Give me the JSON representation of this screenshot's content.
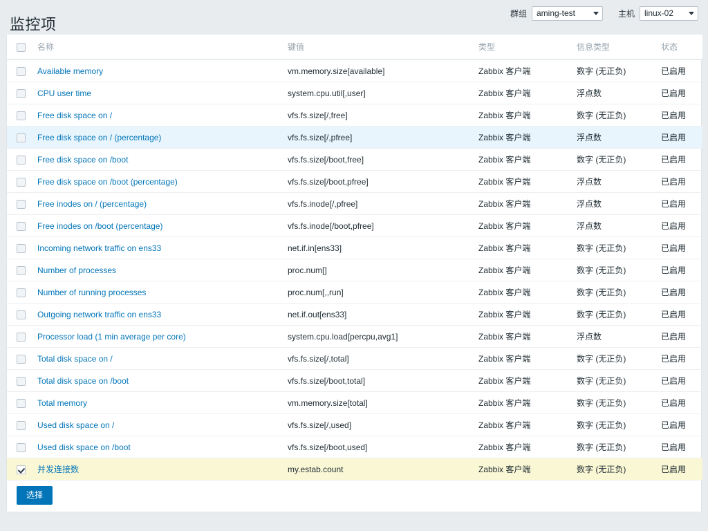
{
  "header": {
    "title": "监控项",
    "filters": [
      {
        "label": "群组",
        "value": "aming-test",
        "name": "group"
      },
      {
        "label": "主机",
        "value": "linux-02",
        "name": "host"
      }
    ]
  },
  "table": {
    "columns": [
      "名称",
      "键值",
      "类型",
      "信息类型",
      "状态"
    ],
    "rows": [
      {
        "name": "Available memory",
        "key": "vm.memory.size[available]",
        "type": "Zabbix 客户端",
        "info": "数字 (无正负)",
        "state": "已启用",
        "checked": false,
        "highlight": "none"
      },
      {
        "name": "CPU user time",
        "key": "system.cpu.util[,user]",
        "type": "Zabbix 客户端",
        "info": "浮点数",
        "state": "已启用",
        "checked": false,
        "highlight": "none"
      },
      {
        "name": "Free disk space on /",
        "key": "vfs.fs.size[/,free]",
        "type": "Zabbix 客户端",
        "info": "数字 (无正负)",
        "state": "已启用",
        "checked": false,
        "highlight": "none"
      },
      {
        "name": "Free disk space on / (percentage)",
        "key": "vfs.fs.size[/,pfree]",
        "type": "Zabbix 客户端",
        "info": "浮点数",
        "state": "已启用",
        "checked": false,
        "highlight": "hover"
      },
      {
        "name": "Free disk space on /boot",
        "key": "vfs.fs.size[/boot,free]",
        "type": "Zabbix 客户端",
        "info": "数字 (无正负)",
        "state": "已启用",
        "checked": false,
        "highlight": "none"
      },
      {
        "name": "Free disk space on /boot (percentage)",
        "key": "vfs.fs.size[/boot,pfree]",
        "type": "Zabbix 客户端",
        "info": "浮点数",
        "state": "已启用",
        "checked": false,
        "highlight": "none"
      },
      {
        "name": "Free inodes on / (percentage)",
        "key": "vfs.fs.inode[/,pfree]",
        "type": "Zabbix 客户端",
        "info": "浮点数",
        "state": "已启用",
        "checked": false,
        "highlight": "none"
      },
      {
        "name": "Free inodes on /boot (percentage)",
        "key": "vfs.fs.inode[/boot,pfree]",
        "type": "Zabbix 客户端",
        "info": "浮点数",
        "state": "已启用",
        "checked": false,
        "highlight": "none"
      },
      {
        "name": "Incoming network traffic on ens33",
        "key": "net.if.in[ens33]",
        "type": "Zabbix 客户端",
        "info": "数字 (无正负)",
        "state": "已启用",
        "checked": false,
        "highlight": "none"
      },
      {
        "name": "Number of processes",
        "key": "proc.num[]",
        "type": "Zabbix 客户端",
        "info": "数字 (无正负)",
        "state": "已启用",
        "checked": false,
        "highlight": "none"
      },
      {
        "name": "Number of running processes",
        "key": "proc.num[,,run]",
        "type": "Zabbix 客户端",
        "info": "数字 (无正负)",
        "state": "已启用",
        "checked": false,
        "highlight": "none"
      },
      {
        "name": "Outgoing network traffic on ens33",
        "key": "net.if.out[ens33]",
        "type": "Zabbix 客户端",
        "info": "数字 (无正负)",
        "state": "已启用",
        "checked": false,
        "highlight": "none"
      },
      {
        "name": "Processor load (1 min average per core)",
        "key": "system.cpu.load[percpu,avg1]",
        "type": "Zabbix 客户端",
        "info": "浮点数",
        "state": "已启用",
        "checked": false,
        "highlight": "none"
      },
      {
        "name": "Total disk space on /",
        "key": "vfs.fs.size[/,total]",
        "type": "Zabbix 客户端",
        "info": "数字 (无正负)",
        "state": "已启用",
        "checked": false,
        "highlight": "none"
      },
      {
        "name": "Total disk space on /boot",
        "key": "vfs.fs.size[/boot,total]",
        "type": "Zabbix 客户端",
        "info": "数字 (无正负)",
        "state": "已启用",
        "checked": false,
        "highlight": "none"
      },
      {
        "name": "Total memory",
        "key": "vm.memory.size[total]",
        "type": "Zabbix 客户端",
        "info": "数字 (无正负)",
        "state": "已启用",
        "checked": false,
        "highlight": "none"
      },
      {
        "name": "Used disk space on /",
        "key": "vfs.fs.size[/,used]",
        "type": "Zabbix 客户端",
        "info": "数字 (无正负)",
        "state": "已启用",
        "checked": false,
        "highlight": "none"
      },
      {
        "name": "Used disk space on /boot",
        "key": "vfs.fs.size[/boot,used]",
        "type": "Zabbix 客户端",
        "info": "数字 (无正负)",
        "state": "已启用",
        "checked": false,
        "highlight": "none"
      },
      {
        "name": "并发连接数",
        "key": "my.estab.count",
        "type": "Zabbix 客户端",
        "info": "数字 (无正负)",
        "state": "已启用",
        "checked": true,
        "highlight": "selected"
      }
    ]
  },
  "footer": {
    "select_button": "选择"
  },
  "colors": {
    "link": "#0275b8",
    "enabled": "#59a325",
    "hover_row": "#e8f5fd",
    "selected_row": "#faf7d5",
    "page_bg": "#e8ecef"
  }
}
